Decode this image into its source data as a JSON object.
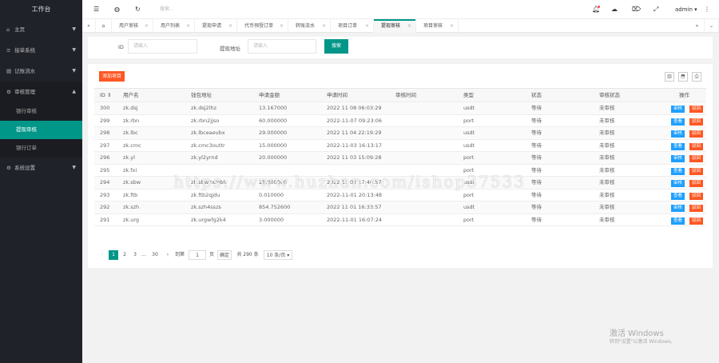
{
  "sidebar": {
    "title": "工作台",
    "items": [
      {
        "label": "主页",
        "icon": "home-icon"
      },
      {
        "label": "接单系统",
        "icon": "list-icon"
      },
      {
        "label": "记账流水",
        "icon": "ledger-icon"
      },
      {
        "label": "审核管理",
        "icon": "audit-icon"
      }
    ],
    "sub": [
      "银行审核",
      "提现审核",
      "银行订单"
    ],
    "last": "系统设置"
  },
  "header": {
    "search": "搜索...",
    "user": "admin"
  },
  "tabs": [
    "用户审核",
    "用户列表",
    "提现申请",
    "代币预授订单",
    "转账流水",
    "项目订单",
    "提现审核",
    "项目审核"
  ],
  "filter": {
    "id_label": "ID",
    "id_ph": "请输入",
    "addr_label": "提现地址",
    "addr_ph": "请输入",
    "search": "搜索"
  },
  "add_button": "添加项目",
  "columns": [
    "ID ⇕",
    "用户名",
    "钱包地址",
    "申请金额",
    "申请时间",
    "审核时间",
    "类型",
    "状态",
    "审核状态",
    "操作"
  ],
  "rows": [
    {
      "id": "300",
      "user": "zk.dsj",
      "addr": "zk.dsj2lhz",
      "amt": "13.167000",
      "time": "2022 11 08 06:03:29",
      "rt": "",
      "type": "usdt",
      "status": "等待",
      "audit": "未审核",
      "a1": "审核",
      "a2": "驳回"
    },
    {
      "id": "299",
      "user": "zk.rbn",
      "addr": "zk.rbn2jjso",
      "amt": "60.000000",
      "time": "2022-11-07 09:23:06",
      "rt": "",
      "type": "port",
      "status": "等待",
      "audit": "未审核",
      "a1": "查看",
      "a2": "驳回"
    },
    {
      "id": "298",
      "user": "zk.lbc",
      "addr": "zk.lbceaevbx",
      "amt": "29.000000",
      "time": "2022 11 04 22:19:29",
      "rt": "",
      "type": "usdt",
      "status": "等待",
      "audit": "未审核",
      "a1": "审核",
      "a2": "驳回"
    },
    {
      "id": "297",
      "user": "zk.cmc",
      "addr": "zk.cmc3outtr",
      "amt": "15.000000",
      "time": "2022-11-03 16:13:17",
      "rt": "",
      "type": "usdt",
      "status": "等待",
      "audit": "未审核",
      "a1": "查看",
      "a2": "驳回"
    },
    {
      "id": "296",
      "user": "zk.yl",
      "addr": "zk.yl2yrnd",
      "amt": "20.000000",
      "time": "2022 11 03 15:09:28",
      "rt": "",
      "type": "port",
      "status": "等待",
      "audit": "未审核",
      "a1": "审核",
      "a2": "驳回"
    },
    {
      "id": "295",
      "user": "zk.fxi",
      "addr": "",
      "amt": "",
      "time": "",
      "rt": "",
      "type": "port",
      "status": "等待",
      "audit": "未审核",
      "a1": "查看",
      "a2": "驳回"
    },
    {
      "id": "294",
      "user": "zk.sbw",
      "addr": "zk.sbw2xmbh",
      "amt": "25.000000",
      "time": "2022 11 02 17:46:57",
      "rt": "",
      "type": "usdt",
      "status": "等待",
      "audit": "未审核",
      "a1": "审核",
      "a2": "驳回"
    },
    {
      "id": "293",
      "user": "zk.ftb",
      "addr": "zk.ftb2qjdu",
      "amt": "0.010000",
      "time": "2022-11-01 20:13:48",
      "rt": "",
      "type": "port",
      "status": "等待",
      "audit": "未审核",
      "a1": "查看",
      "a2": "驳回"
    },
    {
      "id": "292",
      "user": "zk.szh",
      "addr": "zk.szh4sszs",
      "amt": "854.752600",
      "time": "2022 11 01 16:33:57",
      "rt": "",
      "type": "usdt",
      "status": "等待",
      "audit": "未审核",
      "a1": "审核",
      "a2": "驳回"
    },
    {
      "id": "291",
      "user": "zk.urg",
      "addr": "zk.urgwfg2k4",
      "amt": "3.000000",
      "time": "2022-11-01 16:07:24",
      "rt": "",
      "type": "port",
      "status": "等待",
      "audit": "未审核",
      "a1": "查看",
      "a2": "驳回"
    }
  ],
  "pager": {
    "cur": "1",
    "p2": "2",
    "p3": "3",
    "dots": "...",
    "last": "30",
    "goto": "到第",
    "val": "1",
    "page": "页",
    "ok": "确定",
    "total": "共 290 条",
    "size": "10 条/页"
  },
  "watermark": "https://www.huzhan.com/ishop37533",
  "windows": {
    "line1": "激活 Windows",
    "line2": "转到\"设置\"以激活 Windows。"
  }
}
